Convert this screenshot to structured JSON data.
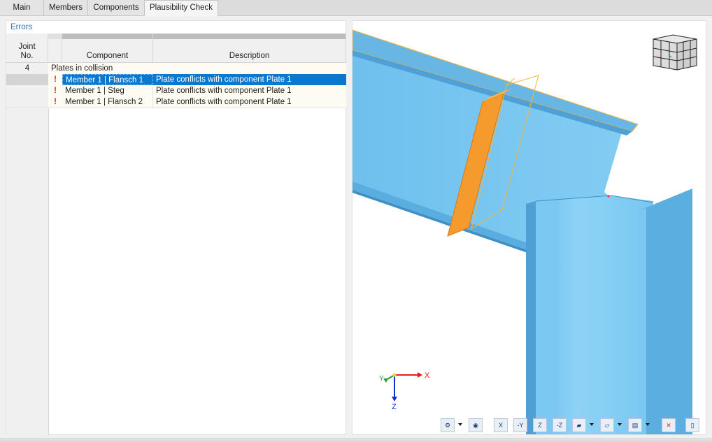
{
  "tabs": [
    {
      "label": "Main",
      "active": false
    },
    {
      "label": "Members",
      "active": false
    },
    {
      "label": "Components",
      "active": false
    },
    {
      "label": "Plausibility Check",
      "active": true
    }
  ],
  "errors_panel": {
    "title": "Errors",
    "columns": {
      "joint": "Joint\nNo.",
      "component": "Component",
      "description": "Description"
    },
    "group": {
      "joint_no": "4",
      "label": "Plates in collision"
    },
    "rows": [
      {
        "component": "Member 1 | Flansch 1",
        "description": "Plate conflicts with component Plate 1",
        "selected": true
      },
      {
        "component": "Member 1 | Steg",
        "description": "Plate conflicts with component Plate 1",
        "selected": false
      },
      {
        "component": "Member 1 | Flansch 2",
        "description": "Plate conflicts with component Plate 1",
        "selected": false
      }
    ],
    "error_icon_glyph": "!",
    "error_icon_color": "#e02020",
    "selection_color": "#0b78d0"
  },
  "viewport": {
    "axes": {
      "x": "X",
      "y": "Y",
      "z": "Z"
    },
    "colors": {
      "member": "#74c5f0",
      "member_dark": "#5aafe0",
      "plate": "#f59a2c",
      "highlight": "#f5b53a",
      "x_axis": "#e02020",
      "y_axis": "#20a030",
      "z_axis": "#1030d0"
    },
    "toolbar": [
      {
        "icon": "view-settings-icon",
        "label": "⚙",
        "dropdown": true
      },
      {
        "icon": "visibility-icon",
        "label": "◉",
        "dropdown": false
      },
      {
        "icon": "view-x-icon",
        "label": "X",
        "dropdown": false
      },
      {
        "icon": "view-minus-y-icon",
        "label": "-Y",
        "dropdown": false
      },
      {
        "icon": "view-z-icon",
        "label": "Z",
        "dropdown": false
      },
      {
        "icon": "view-minus-z-icon",
        "label": "-Z",
        "dropdown": false
      },
      {
        "icon": "render-mode-icon",
        "label": "▰",
        "dropdown": true
      },
      {
        "icon": "iso-view-icon",
        "label": "▱",
        "dropdown": true
      },
      {
        "icon": "print-icon",
        "label": "▤",
        "dropdown": true
      },
      {
        "icon": "zoom-reset-icon",
        "label": "✕",
        "dropdown": false
      },
      {
        "icon": "exit-icon",
        "label": "▯",
        "dropdown": false
      }
    ]
  }
}
